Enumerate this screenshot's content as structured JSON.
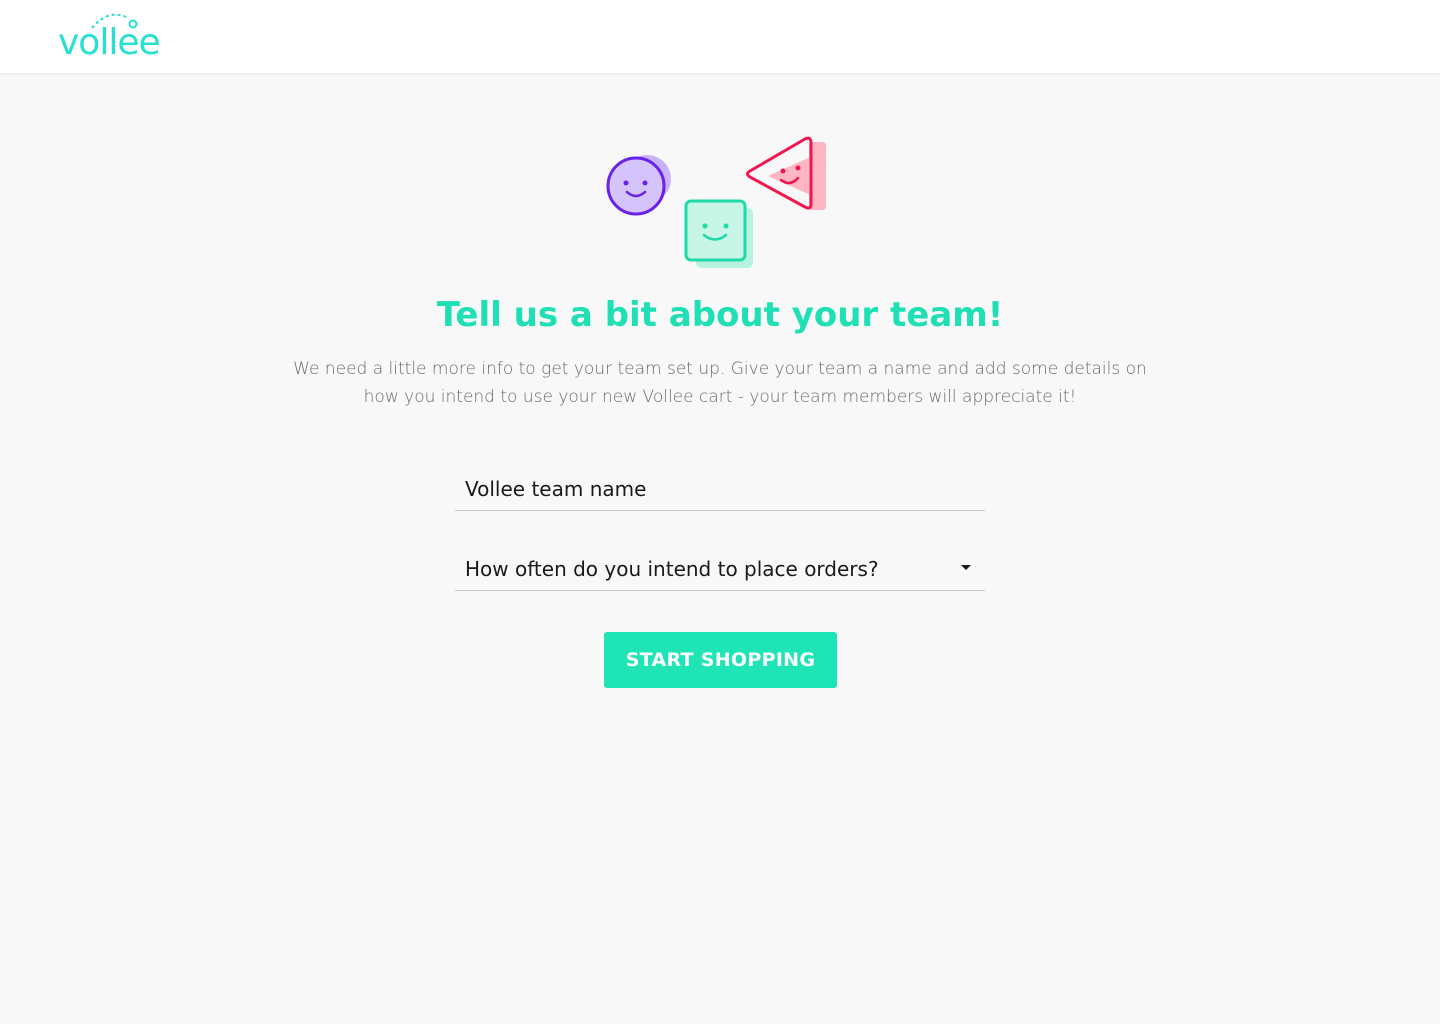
{
  "brand": {
    "logo_text": "vollee",
    "color": "#28e0d2"
  },
  "hero": {
    "icons": [
      "smiley-circle-icon",
      "smiley-square-icon",
      "smiley-triangle-icon"
    ]
  },
  "content": {
    "title": "Tell us a bit about your team!",
    "subtitle": "We need a little more info to get your team set up. Give your team a name and add some details on how you intend to use your new Vollee cart - your team members will appreciate it!"
  },
  "form": {
    "team_name": {
      "placeholder": "Vollee team name",
      "value": ""
    },
    "order_frequency": {
      "placeholder": "How often do you intend to place orders?",
      "selected": ""
    },
    "submit_label": "START SHOPPING"
  },
  "colors": {
    "accent": "#1fe5b6",
    "title": "#1fe0b4",
    "purple": "#6a22e8",
    "red": "#f0174f",
    "background": "#f8f8f8"
  }
}
